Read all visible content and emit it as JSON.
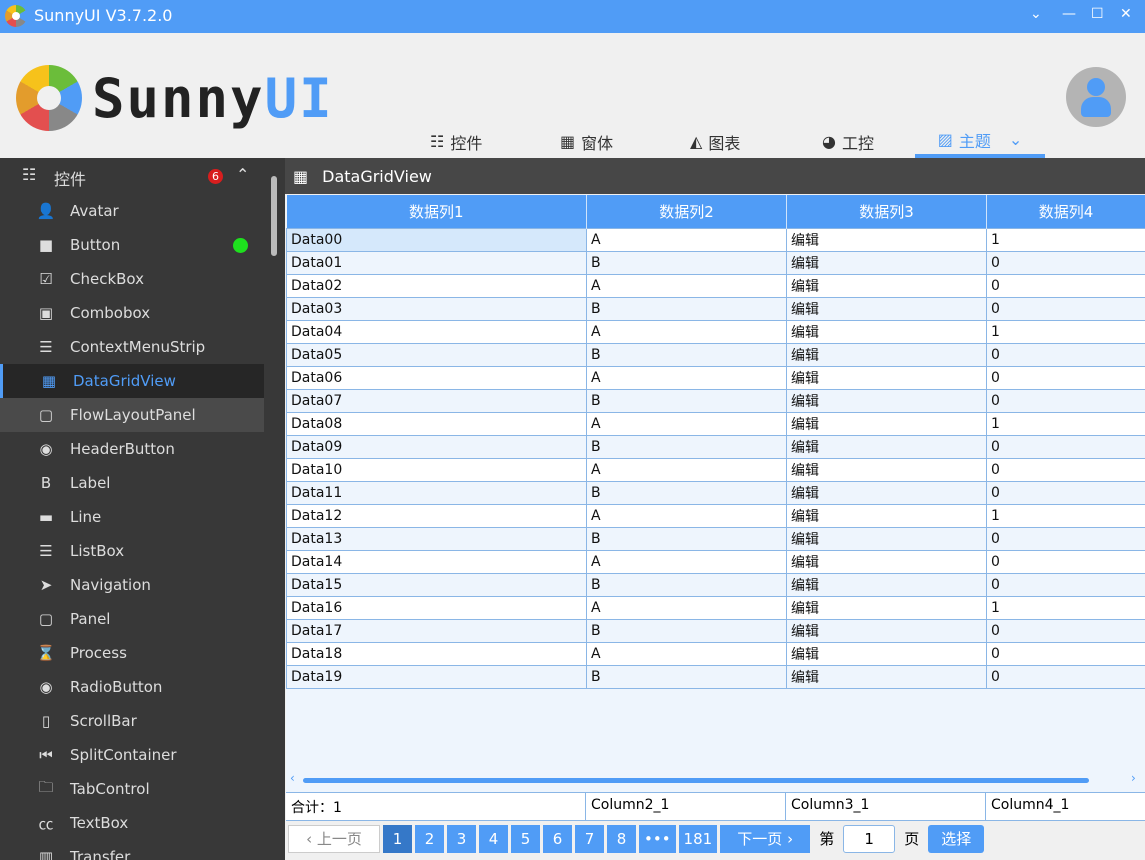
{
  "window": {
    "title": "SunnyUI V3.7.2.0"
  },
  "header": {
    "logo_text_a": "Sunny",
    "logo_text_b": "UI",
    "tabs": [
      {
        "label": "控件",
        "icon": "list-icon"
      },
      {
        "label": "窗体",
        "icon": "windows-icon"
      },
      {
        "label": "图表",
        "icon": "area-chart-icon"
      },
      {
        "label": "工控",
        "icon": "gauge-icon"
      },
      {
        "label": "主题",
        "icon": "image-icon"
      }
    ],
    "selected_tab": "主题"
  },
  "sidebar": {
    "group": "控件",
    "badge": "6",
    "items": [
      {
        "label": "Avatar",
        "icon": "user-icon"
      },
      {
        "label": "Button",
        "icon": "square-icon"
      },
      {
        "label": "CheckBox",
        "icon": "checkbox-icon"
      },
      {
        "label": "Combobox",
        "icon": "combobox-icon"
      },
      {
        "label": "ContextMenuStrip",
        "icon": "menu-icon"
      },
      {
        "label": "DataGridView",
        "icon": "table-icon"
      },
      {
        "label": "FlowLayoutPanel",
        "icon": "square-outline-icon"
      },
      {
        "label": "HeaderButton",
        "icon": "user-circle-icon"
      },
      {
        "label": "Label",
        "icon": "bold-icon"
      },
      {
        "label": "Line",
        "icon": "line-icon"
      },
      {
        "label": "ListBox",
        "icon": "listbox-icon"
      },
      {
        "label": "Navigation",
        "icon": "paper-plane-icon"
      },
      {
        "label": "Panel",
        "icon": "square-outline-icon"
      },
      {
        "label": "Process",
        "icon": "hourglass-icon"
      },
      {
        "label": "RadioButton",
        "icon": "radio-icon"
      },
      {
        "label": "ScrollBar",
        "icon": "mobile-icon"
      },
      {
        "label": "SplitContainer",
        "icon": "step-backward-icon"
      },
      {
        "label": "TabControl",
        "icon": "folder-icon"
      },
      {
        "label": "TextBox",
        "icon": "cc-icon"
      },
      {
        "label": "Transfer",
        "icon": "columns-icon"
      }
    ]
  },
  "main": {
    "title": "DataGridView",
    "columns": [
      "数据列1",
      "数据列2",
      "数据列3",
      "数据列4"
    ],
    "rows": [
      [
        "Data00",
        "A",
        "编辑",
        "1"
      ],
      [
        "Data01",
        "B",
        "编辑",
        "0"
      ],
      [
        "Data02",
        "A",
        "编辑",
        "0"
      ],
      [
        "Data03",
        "B",
        "编辑",
        "0"
      ],
      [
        "Data04",
        "A",
        "编辑",
        "1"
      ],
      [
        "Data05",
        "B",
        "编辑",
        "0"
      ],
      [
        "Data06",
        "A",
        "编辑",
        "0"
      ],
      [
        "Data07",
        "B",
        "编辑",
        "0"
      ],
      [
        "Data08",
        "A",
        "编辑",
        "1"
      ],
      [
        "Data09",
        "B",
        "编辑",
        "0"
      ],
      [
        "Data10",
        "A",
        "编辑",
        "0"
      ],
      [
        "Data11",
        "B",
        "编辑",
        "0"
      ],
      [
        "Data12",
        "A",
        "编辑",
        "1"
      ],
      [
        "Data13",
        "B",
        "编辑",
        "0"
      ],
      [
        "Data14",
        "A",
        "编辑",
        "0"
      ],
      [
        "Data15",
        "B",
        "编辑",
        "0"
      ],
      [
        "Data16",
        "A",
        "编辑",
        "1"
      ],
      [
        "Data17",
        "B",
        "编辑",
        "0"
      ],
      [
        "Data18",
        "A",
        "编辑",
        "0"
      ],
      [
        "Data19",
        "B",
        "编辑",
        "0"
      ]
    ],
    "summary": [
      "合计：1",
      "Column2_1",
      "Column3_1",
      "Column4_1"
    ],
    "pager": {
      "prev": "上一页",
      "pages": [
        "1",
        "2",
        "3",
        "4",
        "5",
        "6",
        "7",
        "8",
        "•••",
        "181"
      ],
      "next": "下一页",
      "page_prefix": "第",
      "page_value": "1",
      "page_suffix": "页",
      "select": "选择"
    }
  }
}
